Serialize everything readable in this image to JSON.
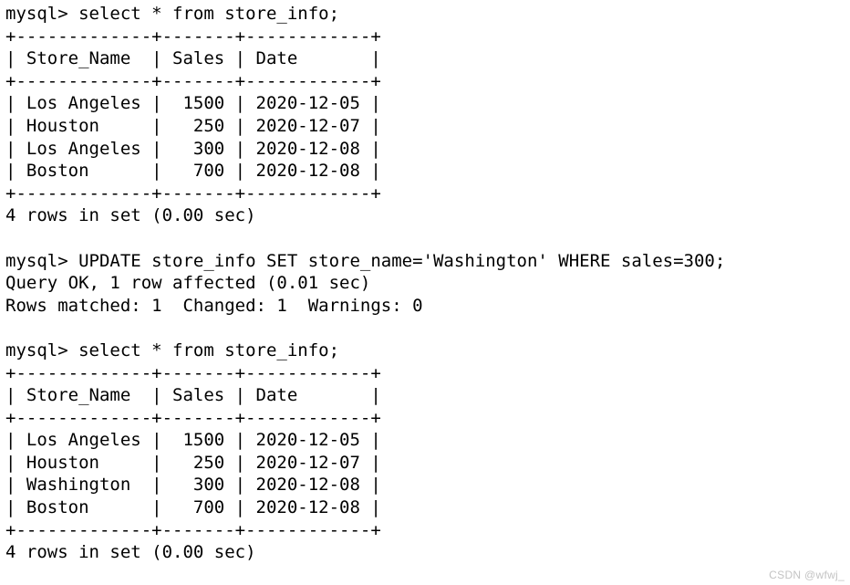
{
  "terminal": {
    "prompt": "mysql> ",
    "lines": [
      {
        "id": "cmd-select-1",
        "kind": "command",
        "text": "mysql> select * from store_info;"
      },
      {
        "id": "rule-top-1",
        "kind": "table-rule",
        "text": "+-------------+-------+------------+"
      },
      {
        "id": "header-1",
        "kind": "table-header",
        "text": "| Store_Name  | Sales | Date       |"
      },
      {
        "id": "rule-mid-1",
        "kind": "table-rule",
        "text": "+-------------+-------+------------+"
      },
      {
        "id": "row-1-1",
        "kind": "table-row",
        "text": "| Los Angeles |  1500 | 2020-12-05 |"
      },
      {
        "id": "row-1-2",
        "kind": "table-row",
        "text": "| Houston     |   250 | 2020-12-07 |"
      },
      {
        "id": "row-1-3",
        "kind": "table-row",
        "text": "| Los Angeles |   300 | 2020-12-08 |"
      },
      {
        "id": "row-1-4",
        "kind": "table-row",
        "text": "| Boston      |   700 | 2020-12-08 |"
      },
      {
        "id": "rule-bot-1",
        "kind": "table-rule",
        "text": "+-------------+-------+------------+"
      },
      {
        "id": "status-1",
        "kind": "status",
        "text": "4 rows in set (0.00 sec)"
      },
      {
        "id": "blank-1",
        "kind": "blank",
        "text": ""
      },
      {
        "id": "cmd-update",
        "kind": "command",
        "text": "mysql> UPDATE store_info SET store_name='Washington' WHERE sales=300;"
      },
      {
        "id": "status-update-1",
        "kind": "status",
        "text": "Query OK, 1 row affected (0.01 sec)"
      },
      {
        "id": "status-update-2",
        "kind": "status",
        "text": "Rows matched: 1  Changed: 1  Warnings: 0"
      },
      {
        "id": "blank-2",
        "kind": "blank",
        "text": ""
      },
      {
        "id": "cmd-select-2",
        "kind": "command",
        "text": "mysql> select * from store_info;"
      },
      {
        "id": "rule-top-2",
        "kind": "table-rule",
        "text": "+-------------+-------+------------+"
      },
      {
        "id": "header-2",
        "kind": "table-header",
        "text": "| Store_Name  | Sales | Date       |"
      },
      {
        "id": "rule-mid-2",
        "kind": "table-rule",
        "text": "+-------------+-------+------------+"
      },
      {
        "id": "row-2-1",
        "kind": "table-row",
        "text": "| Los Angeles |  1500 | 2020-12-05 |"
      },
      {
        "id": "row-2-2",
        "kind": "table-row",
        "text": "| Houston     |   250 | 2020-12-07 |"
      },
      {
        "id": "row-2-3",
        "kind": "table-row",
        "text": "| Washington  |   300 | 2020-12-08 |"
      },
      {
        "id": "row-2-4",
        "kind": "table-row",
        "text": "| Boston      |   700 | 2020-12-08 |"
      },
      {
        "id": "rule-bot-2",
        "kind": "table-rule",
        "text": "+-------------+-------+------------+"
      },
      {
        "id": "status-2",
        "kind": "status",
        "text": "4 rows in set (0.00 sec)"
      }
    ],
    "queries": {
      "select_statement": "select * from store_info;",
      "update_statement": "UPDATE store_info SET store_name='Washington' WHERE sales=300;"
    },
    "result_sets": [
      {
        "name": "store_info-before-update",
        "columns": [
          "Store_Name",
          "Sales",
          "Date"
        ],
        "rows": [
          [
            "Los Angeles",
            "1500",
            "2020-12-05"
          ],
          [
            "Houston",
            "250",
            "2020-12-07"
          ],
          [
            "Los Angeles",
            "300",
            "2020-12-08"
          ],
          [
            "Boston",
            "700",
            "2020-12-08"
          ]
        ],
        "footer": "4 rows in set (0.00 sec)",
        "row_count": 4,
        "elapsed": "0.00 sec"
      },
      {
        "name": "store_info-after-update",
        "columns": [
          "Store_Name",
          "Sales",
          "Date"
        ],
        "rows": [
          [
            "Los Angeles",
            "1500",
            "2020-12-05"
          ],
          [
            "Houston",
            "250",
            "2020-12-07"
          ],
          [
            "Washington",
            "300",
            "2020-12-08"
          ],
          [
            "Boston",
            "700",
            "2020-12-08"
          ]
        ],
        "footer": "4 rows in set (0.00 sec)",
        "row_count": 4,
        "elapsed": "0.00 sec"
      }
    ],
    "update_result": {
      "status": "Query OK, 1 row affected (0.01 sec)",
      "details": "Rows matched: 1  Changed: 1  Warnings: 0",
      "rows_affected": 1,
      "rows_matched": 1,
      "changed": 1,
      "warnings": 0,
      "elapsed": "0.01 sec"
    },
    "colors": {
      "background": "#ffffff",
      "foreground": "#000000",
      "watermark": "#c3c3c3"
    }
  },
  "watermark": {
    "text": "CSDN @wfwj_"
  }
}
